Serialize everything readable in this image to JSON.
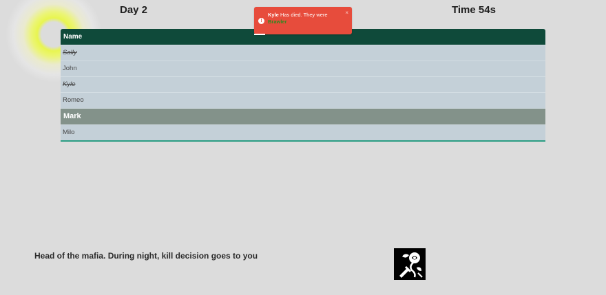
{
  "header": {
    "day_label": "Day 2",
    "time_label": "Time 54s",
    "sun_icon": "sun-icon"
  },
  "table": {
    "header": "Name",
    "players": [
      {
        "name": "Sally",
        "status": "dead"
      },
      {
        "name": "John",
        "status": "alive"
      },
      {
        "name": "Kyle",
        "status": "dead"
      },
      {
        "name": "Romeo",
        "status": "alive"
      },
      {
        "name": "Mark",
        "status": "current"
      },
      {
        "name": "Milo",
        "status": "alive"
      }
    ]
  },
  "toast": {
    "player": "Kyle",
    "message": "Has died. They were",
    "role": "Brawler",
    "close": "×",
    "icon": "alert-icon",
    "color": "#e74c3c"
  },
  "role": {
    "description": "Head of the mafia. During night, kill decision goes to you",
    "icon": "rose-dagger-icon"
  },
  "colors": {
    "table_header": "#0f4a3a",
    "row_bg": "#c4d0d8",
    "current_row_bg": "#83928a",
    "accent": "#2a9d83"
  }
}
